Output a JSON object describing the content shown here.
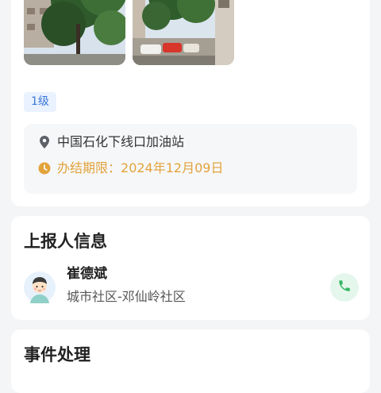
{
  "event": {
    "level": "1级",
    "location": "中国石化下线口加油站",
    "deadline_label": "办结期限：",
    "deadline_value": "2024年12月09日"
  },
  "reporter": {
    "title": "上报人信息",
    "name": "崔德斌",
    "org": "城市社区-邓仙岭社区"
  },
  "process": {
    "title": "事件处理"
  },
  "icons": {
    "location": "location-pin-icon",
    "deadline": "clock-icon",
    "call": "phone-icon"
  },
  "colors": {
    "accent_blue": "#3a78d8",
    "deadline_orange": "#e2a33b",
    "call_green": "#35b865"
  }
}
